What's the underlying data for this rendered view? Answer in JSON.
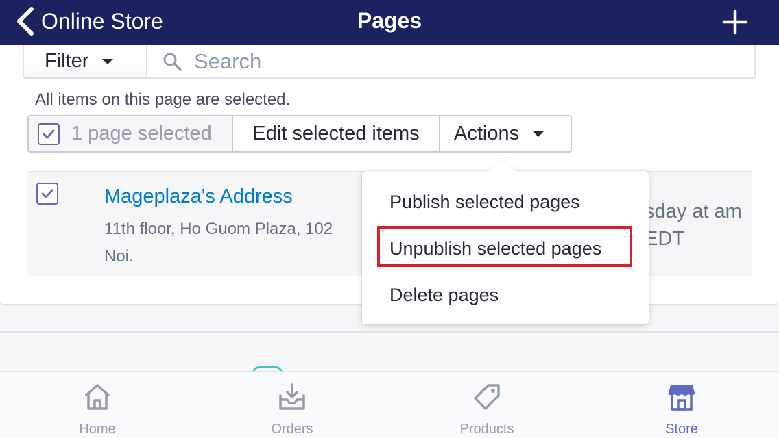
{
  "header": {
    "back_label": "Online Store",
    "title": "Pages"
  },
  "filter": {
    "filter_label": "Filter",
    "search_placeholder": "Search"
  },
  "selection": {
    "all_selected_text": "All items on this page are selected.",
    "selected_label": "1 page selected",
    "edit_label": "Edit selected items",
    "actions_label": "Actions"
  },
  "page_row": {
    "title": "Mageplaza's Address",
    "description": "11th floor, Ho Guom Plaza, 102 Noi.",
    "date_fragment": "sday at am EDT"
  },
  "actions_menu": {
    "items": [
      "Publish selected pages",
      "Unpublish selected pages",
      "Delete pages"
    ],
    "highlighted_item": "Unpublish selected pages"
  },
  "tabs": [
    {
      "label": "Home",
      "icon": "home-icon"
    },
    {
      "label": "Orders",
      "icon": "orders-icon"
    },
    {
      "label": "Products",
      "icon": "tag-icon"
    },
    {
      "label": "Store",
      "icon": "store-icon"
    }
  ],
  "active_tab": "Store",
  "colors": {
    "topbar": "#1c2260",
    "accent": "#5c6ac4",
    "link": "#007ace",
    "highlight_border": "#d9212b"
  }
}
